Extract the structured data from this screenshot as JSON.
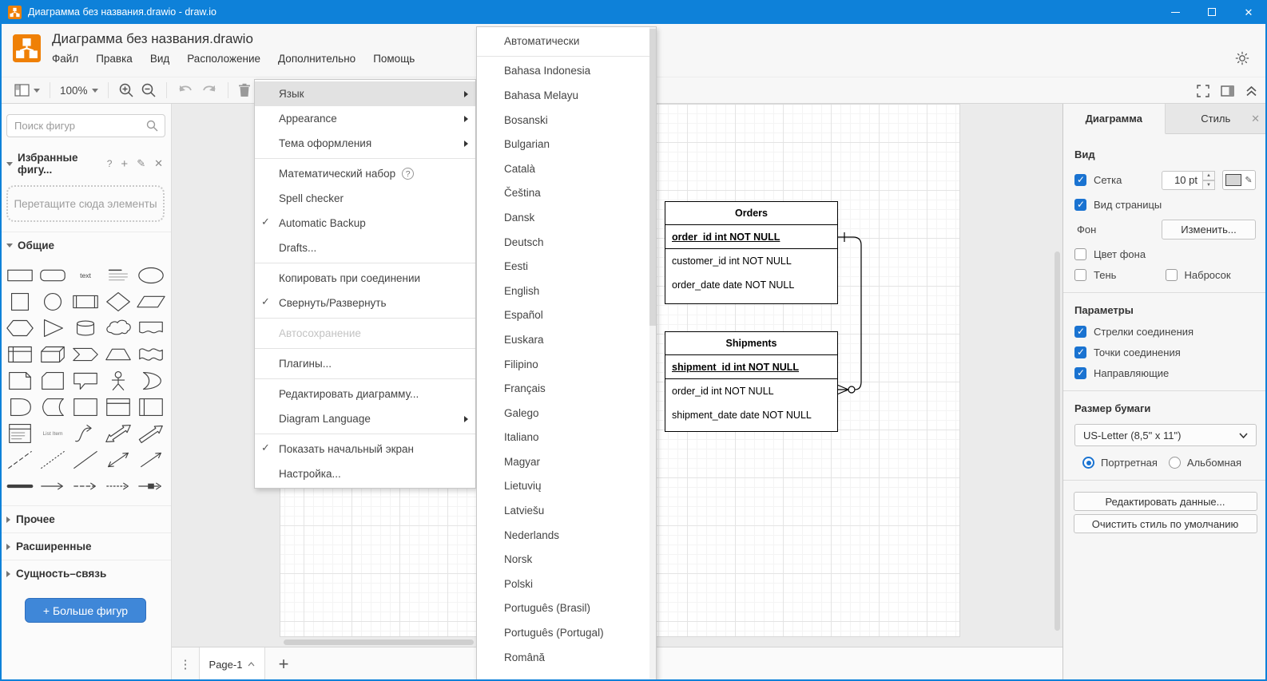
{
  "window": {
    "title": "Диаграмма без названия.drawio - draw.io"
  },
  "header": {
    "title": "Диаграмма без названия.drawio",
    "menus": [
      "Файл",
      "Правка",
      "Вид",
      "Расположение",
      "Дополнительно",
      "Помощь"
    ]
  },
  "toolbar": {
    "zoom_level": "100%"
  },
  "sidebar": {
    "search_placeholder": "Поиск фигур",
    "favorites_title": "Избранные фигу...",
    "favorites_help": "?",
    "dropzone_text": "Перетащите сюда элементы",
    "sections": {
      "general": "Общие",
      "misc": "Прочее",
      "advanced": "Расширенные",
      "er": "Сущность–связь"
    },
    "more_shapes_label": "+ Больше фигур",
    "shapes": [
      "rectangle",
      "rounded-rectangle",
      "text",
      "textbox",
      "ellipse",
      "square",
      "circle",
      "process",
      "diamond",
      "parallelogram",
      "hexagon",
      "triangle",
      "cylinder",
      "cloud",
      "document",
      "internal-storage",
      "cube",
      "step",
      "trapezoid",
      "tape",
      "note",
      "card",
      "callout",
      "actor",
      "or",
      "and",
      "data-storage",
      "container",
      "container-title",
      "container-side",
      "list",
      "list-item",
      "curve",
      "bidirectional-arrow",
      "arrow",
      "dashed-line",
      "dotted-line",
      "line",
      "bidirectional-connector",
      "directional-connector",
      "link",
      "arrow-edge",
      "dashed-edge",
      "dashed-edge-2",
      "labeled-edge"
    ]
  },
  "more_menu": {
    "items": [
      {
        "label": "Язык",
        "submenu": true,
        "highlighted": true
      },
      {
        "label": "Appearance",
        "submenu": true
      },
      {
        "label": "Тема оформления",
        "submenu": true
      },
      {
        "sep": true
      },
      {
        "label": "Математический набор",
        "help": true
      },
      {
        "label": "Spell checker"
      },
      {
        "label": "Automatic Backup",
        "checked": true
      },
      {
        "label": "Drafts..."
      },
      {
        "sep": true
      },
      {
        "label": "Копировать при соединении"
      },
      {
        "label": "Свернуть/Развернуть",
        "checked": true
      },
      {
        "sep": true
      },
      {
        "label": "Автосохранение",
        "disabled": true
      },
      {
        "sep": true
      },
      {
        "label": "Плагины..."
      },
      {
        "sep": true
      },
      {
        "label": "Редактировать диаграмму..."
      },
      {
        "label": "Diagram Language",
        "submenu": true
      },
      {
        "sep": true
      },
      {
        "label": "Показать начальный экран",
        "checked": true
      },
      {
        "label": "Настройка..."
      }
    ]
  },
  "language_menu": {
    "items": [
      {
        "label": "Автоматически"
      },
      {
        "sep": true
      },
      {
        "label": "Bahasa Indonesia"
      },
      {
        "label": "Bahasa Melayu"
      },
      {
        "label": "Bosanski"
      },
      {
        "label": "Bulgarian"
      },
      {
        "label": "Català"
      },
      {
        "label": "Čeština"
      },
      {
        "label": "Dansk"
      },
      {
        "label": "Deutsch"
      },
      {
        "label": "Eesti"
      },
      {
        "label": "English"
      },
      {
        "label": "Español"
      },
      {
        "label": "Euskara"
      },
      {
        "label": "Filipino"
      },
      {
        "label": "Français"
      },
      {
        "label": "Galego"
      },
      {
        "label": "Italiano"
      },
      {
        "label": "Magyar"
      },
      {
        "label": "Lietuvių"
      },
      {
        "label": "Latviešu"
      },
      {
        "label": "Nederlands"
      },
      {
        "label": "Norsk"
      },
      {
        "label": "Polski"
      },
      {
        "label": "Português (Brasil)"
      },
      {
        "label": "Português (Portugal)"
      },
      {
        "label": "Română"
      }
    ]
  },
  "canvas": {
    "tables": [
      {
        "title": "Orders",
        "rows": [
          {
            "text": "order_id int NOT NULL",
            "pk": true
          },
          {
            "text": "customer_id int NOT NULL"
          },
          {
            "text": "order_date date NOT NULL"
          }
        ]
      },
      {
        "title": "Shipments",
        "rows": [
          {
            "text": "shipment_id int NOT NULL",
            "pk": true
          },
          {
            "text": "order_id int NOT NULL"
          },
          {
            "text": "shipment_date date NOT NULL"
          }
        ]
      }
    ]
  },
  "format_panel": {
    "tabs": [
      "Диаграмма",
      "Стиль"
    ],
    "view": {
      "heading": "Вид",
      "grid_label": "Сетка",
      "grid_size": "10 pt",
      "page_view_label": "Вид страницы",
      "background_label": "Фон",
      "change_button": "Изменить...",
      "bg_color_label": "Цвет фона",
      "shadow_label": "Тень",
      "sketch_label": "Набросок"
    },
    "options": {
      "heading": "Параметры",
      "items": [
        "Стрелки соединения",
        "Точки соединения",
        "Направляющие"
      ]
    },
    "paper": {
      "heading": "Размер бумаги",
      "size_value": "US-Letter (8,5\" x 11\")",
      "portrait_label": "Портретная",
      "landscape_label": "Альбомная"
    },
    "buttons": {
      "edit_data": "Редактировать данные...",
      "clear_default_style": "Очистить стиль по умолчанию"
    }
  },
  "footer": {
    "page_tab": "Page-1"
  },
  "icons": [
    "app-logo",
    "sun",
    "page-view",
    "zoom-in",
    "zoom-out",
    "undo",
    "redo",
    "trash",
    "fullscreen",
    "format-panel",
    "collapse",
    "search",
    "question",
    "plus",
    "pencil",
    "close"
  ],
  "colors": {
    "titlebar": "#0e81d9",
    "accent_checkbox": "#1a73d1",
    "more_shapes_button": "#3f87d8",
    "menu_highlight": "#e2e2e2"
  }
}
